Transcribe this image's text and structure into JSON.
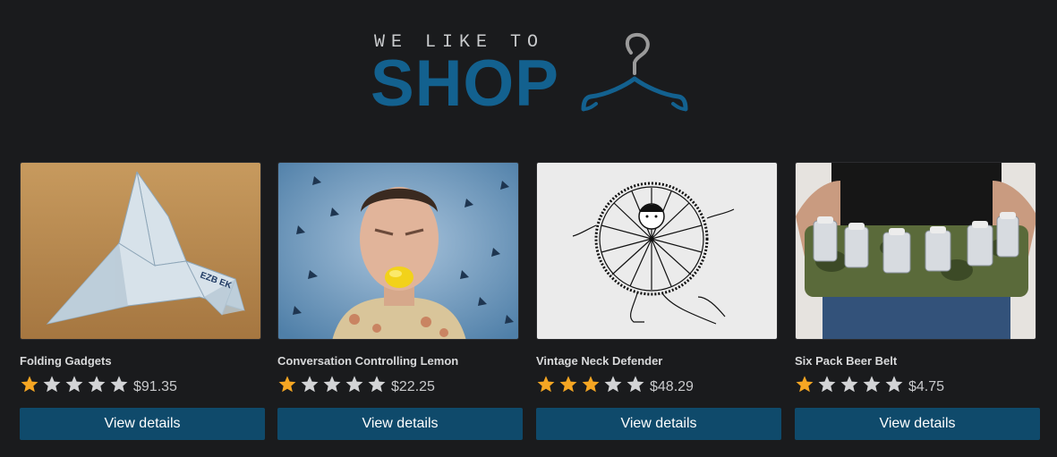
{
  "logo": {
    "tagline": "WE LIKE TO",
    "word": "SHOP",
    "icon": "hanger-icon",
    "colors": {
      "word": "#13618f",
      "hook": "#9a9a9a",
      "tagline": "#c9cbcd"
    }
  },
  "colors": {
    "background": "#1a1b1d",
    "button": "#0f4a6b",
    "star_filled": "#f5a623",
    "star_empty": "#d3d4d6"
  },
  "products": [
    {
      "title": "Folding Gadgets",
      "rating": 1,
      "max_rating": 5,
      "price": "$91.35",
      "button_label": "View details",
      "image": "origami-banknote-bird"
    },
    {
      "title": "Conversation Controlling Lemon",
      "rating": 1,
      "max_rating": 5,
      "price": "$22.25",
      "button_label": "View details",
      "image": "man-with-lemon-in-mouth"
    },
    {
      "title": "Vintage Neck Defender",
      "rating": 3,
      "max_rating": 5,
      "price": "$48.29",
      "button_label": "View details",
      "image": "vintage-ruff-illustration"
    },
    {
      "title": "Six Pack Beer Belt",
      "rating": 1,
      "max_rating": 5,
      "price": "$4.75",
      "button_label": "View details",
      "image": "camo-beer-can-belt"
    }
  ]
}
